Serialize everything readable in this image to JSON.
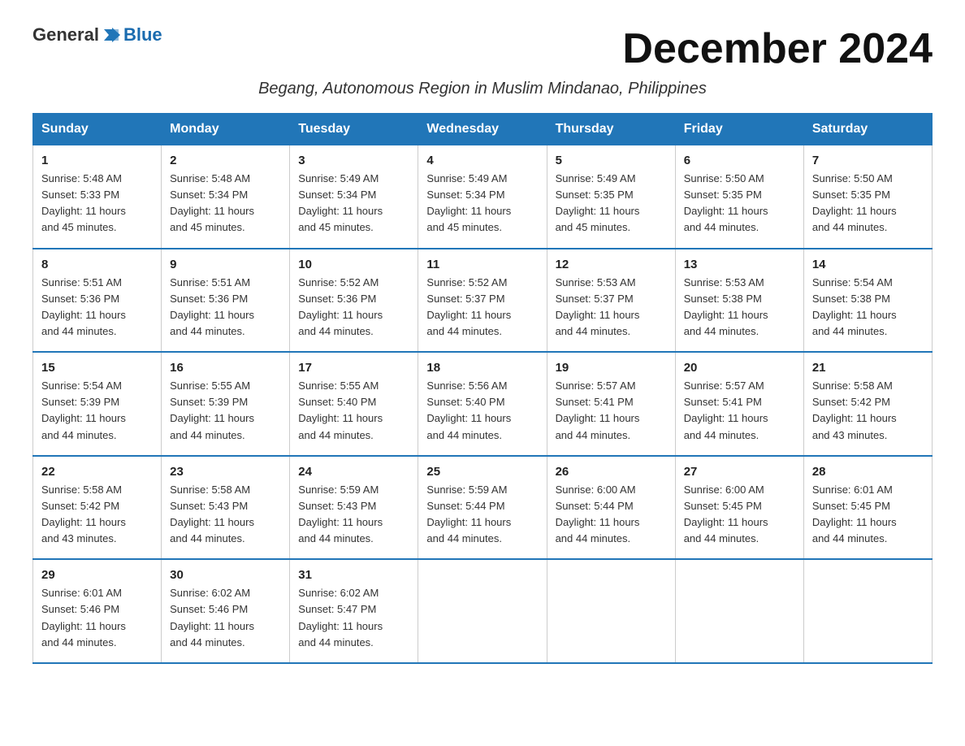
{
  "logo": {
    "text_general": "General",
    "text_blue": "Blue",
    "arrow_color": "#2176b8"
  },
  "title": "December 2024",
  "subtitle": "Begang, Autonomous Region in Muslim Mindanao, Philippines",
  "days_of_week": [
    "Sunday",
    "Monday",
    "Tuesday",
    "Wednesday",
    "Thursday",
    "Friday",
    "Saturday"
  ],
  "weeks": [
    [
      {
        "day": 1,
        "sunrise": "5:48 AM",
        "sunset": "5:33 PM",
        "daylight": "11 hours and 45 minutes."
      },
      {
        "day": 2,
        "sunrise": "5:48 AM",
        "sunset": "5:34 PM",
        "daylight": "11 hours and 45 minutes."
      },
      {
        "day": 3,
        "sunrise": "5:49 AM",
        "sunset": "5:34 PM",
        "daylight": "11 hours and 45 minutes."
      },
      {
        "day": 4,
        "sunrise": "5:49 AM",
        "sunset": "5:34 PM",
        "daylight": "11 hours and 45 minutes."
      },
      {
        "day": 5,
        "sunrise": "5:49 AM",
        "sunset": "5:35 PM",
        "daylight": "11 hours and 45 minutes."
      },
      {
        "day": 6,
        "sunrise": "5:50 AM",
        "sunset": "5:35 PM",
        "daylight": "11 hours and 44 minutes."
      },
      {
        "day": 7,
        "sunrise": "5:50 AM",
        "sunset": "5:35 PM",
        "daylight": "11 hours and 44 minutes."
      }
    ],
    [
      {
        "day": 8,
        "sunrise": "5:51 AM",
        "sunset": "5:36 PM",
        "daylight": "11 hours and 44 minutes."
      },
      {
        "day": 9,
        "sunrise": "5:51 AM",
        "sunset": "5:36 PM",
        "daylight": "11 hours and 44 minutes."
      },
      {
        "day": 10,
        "sunrise": "5:52 AM",
        "sunset": "5:36 PM",
        "daylight": "11 hours and 44 minutes."
      },
      {
        "day": 11,
        "sunrise": "5:52 AM",
        "sunset": "5:37 PM",
        "daylight": "11 hours and 44 minutes."
      },
      {
        "day": 12,
        "sunrise": "5:53 AM",
        "sunset": "5:37 PM",
        "daylight": "11 hours and 44 minutes."
      },
      {
        "day": 13,
        "sunrise": "5:53 AM",
        "sunset": "5:38 PM",
        "daylight": "11 hours and 44 minutes."
      },
      {
        "day": 14,
        "sunrise": "5:54 AM",
        "sunset": "5:38 PM",
        "daylight": "11 hours and 44 minutes."
      }
    ],
    [
      {
        "day": 15,
        "sunrise": "5:54 AM",
        "sunset": "5:39 PM",
        "daylight": "11 hours and 44 minutes."
      },
      {
        "day": 16,
        "sunrise": "5:55 AM",
        "sunset": "5:39 PM",
        "daylight": "11 hours and 44 minutes."
      },
      {
        "day": 17,
        "sunrise": "5:55 AM",
        "sunset": "5:40 PM",
        "daylight": "11 hours and 44 minutes."
      },
      {
        "day": 18,
        "sunrise": "5:56 AM",
        "sunset": "5:40 PM",
        "daylight": "11 hours and 44 minutes."
      },
      {
        "day": 19,
        "sunrise": "5:57 AM",
        "sunset": "5:41 PM",
        "daylight": "11 hours and 44 minutes."
      },
      {
        "day": 20,
        "sunrise": "5:57 AM",
        "sunset": "5:41 PM",
        "daylight": "11 hours and 44 minutes."
      },
      {
        "day": 21,
        "sunrise": "5:58 AM",
        "sunset": "5:42 PM",
        "daylight": "11 hours and 43 minutes."
      }
    ],
    [
      {
        "day": 22,
        "sunrise": "5:58 AM",
        "sunset": "5:42 PM",
        "daylight": "11 hours and 43 minutes."
      },
      {
        "day": 23,
        "sunrise": "5:58 AM",
        "sunset": "5:43 PM",
        "daylight": "11 hours and 44 minutes."
      },
      {
        "day": 24,
        "sunrise": "5:59 AM",
        "sunset": "5:43 PM",
        "daylight": "11 hours and 44 minutes."
      },
      {
        "day": 25,
        "sunrise": "5:59 AM",
        "sunset": "5:44 PM",
        "daylight": "11 hours and 44 minutes."
      },
      {
        "day": 26,
        "sunrise": "6:00 AM",
        "sunset": "5:44 PM",
        "daylight": "11 hours and 44 minutes."
      },
      {
        "day": 27,
        "sunrise": "6:00 AM",
        "sunset": "5:45 PM",
        "daylight": "11 hours and 44 minutes."
      },
      {
        "day": 28,
        "sunrise": "6:01 AM",
        "sunset": "5:45 PM",
        "daylight": "11 hours and 44 minutes."
      }
    ],
    [
      {
        "day": 29,
        "sunrise": "6:01 AM",
        "sunset": "5:46 PM",
        "daylight": "11 hours and 44 minutes."
      },
      {
        "day": 30,
        "sunrise": "6:02 AM",
        "sunset": "5:46 PM",
        "daylight": "11 hours and 44 minutes."
      },
      {
        "day": 31,
        "sunrise": "6:02 AM",
        "sunset": "5:47 PM",
        "daylight": "11 hours and 44 minutes."
      },
      null,
      null,
      null,
      null
    ]
  ],
  "labels": {
    "sunrise": "Sunrise:",
    "sunset": "Sunset:",
    "daylight": "Daylight:"
  }
}
